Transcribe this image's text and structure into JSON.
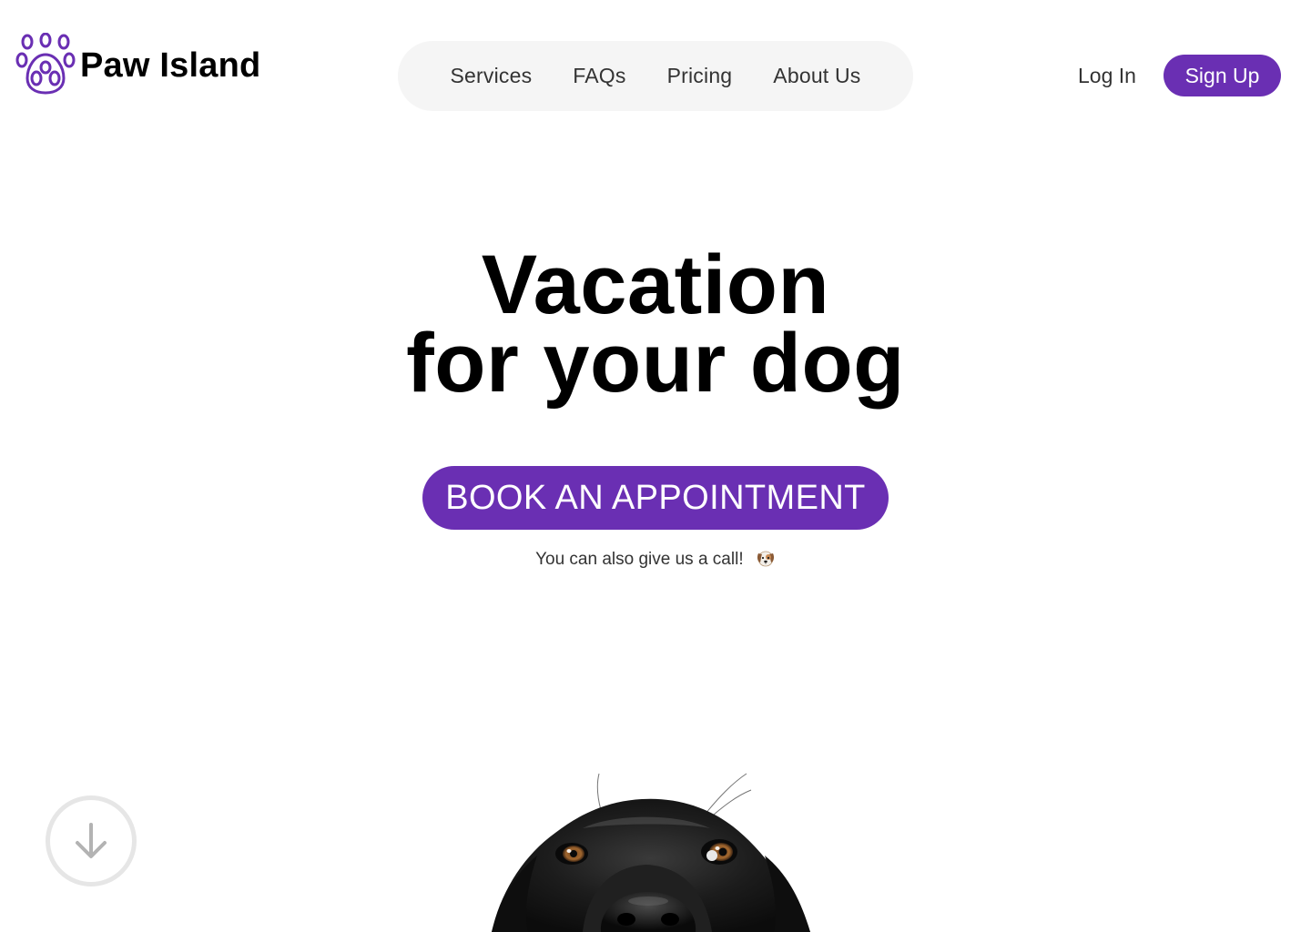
{
  "brand": {
    "name": "Paw Island",
    "logo_icon": "paw-icon",
    "accent_color": "#6a2fb3"
  },
  "nav": {
    "items": [
      {
        "label": "Services"
      },
      {
        "label": "FAQs"
      },
      {
        "label": "Pricing"
      },
      {
        "label": "About Us"
      }
    ]
  },
  "auth": {
    "login_label": "Log In",
    "signup_label": "Sign Up"
  },
  "hero": {
    "title_line_1": "Vacation",
    "title_line_2": "for your dog",
    "cta_label": "BOOK AN APPOINTMENT",
    "call_note": "You can also give us a call!",
    "call_note_icon": "dog-face-icon"
  },
  "scroll": {
    "icon": "arrow-down-icon"
  },
  "image": {
    "subject": "dog-photo"
  }
}
